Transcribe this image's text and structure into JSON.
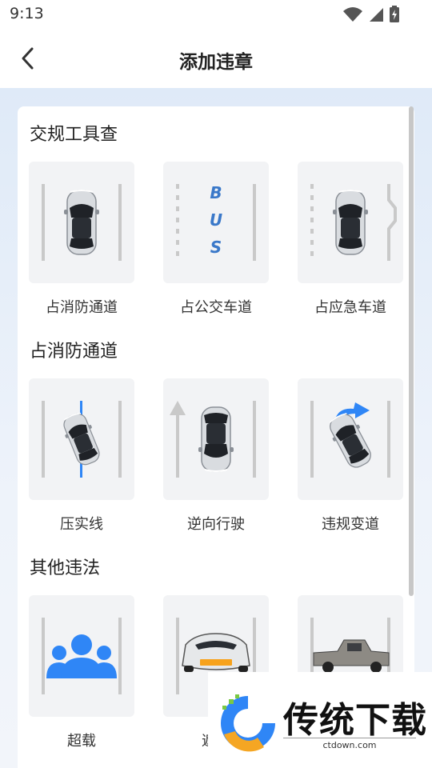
{
  "status_bar": {
    "time": "9:13"
  },
  "header": {
    "title": "添加违章"
  },
  "sections": [
    {
      "title": "交规工具查",
      "items": [
        {
          "label": "占消防通道",
          "icon": "car-fire-lane-icon"
        },
        {
          "label": "占公交车道",
          "icon": "bus-lane-icon",
          "bus_letters": [
            "B",
            "U",
            "S"
          ]
        },
        {
          "label": "占应急车道",
          "icon": "car-emergency-lane-icon"
        }
      ]
    },
    {
      "title": "占消防通道",
      "items": [
        {
          "label": "压实线",
          "icon": "car-solid-line-icon"
        },
        {
          "label": "逆向行驶",
          "icon": "car-wrong-way-icon"
        },
        {
          "label": "违规变道",
          "icon": "car-lane-change-icon"
        }
      ]
    },
    {
      "title": "其他违法",
      "items": [
        {
          "label": "超载",
          "icon": "people-overload-icon"
        },
        {
          "label": "遮挡",
          "icon": "sports-car-plate-icon"
        },
        {
          "label": "",
          "icon": "pickup-truck-icon"
        }
      ]
    }
  ],
  "watermark": {
    "text": "传统下载",
    "url": "ctdown.com"
  },
  "colors": {
    "accent": "#2f86f6",
    "tile_bg": "#f2f3f5",
    "lane": "#c9c9c9"
  }
}
